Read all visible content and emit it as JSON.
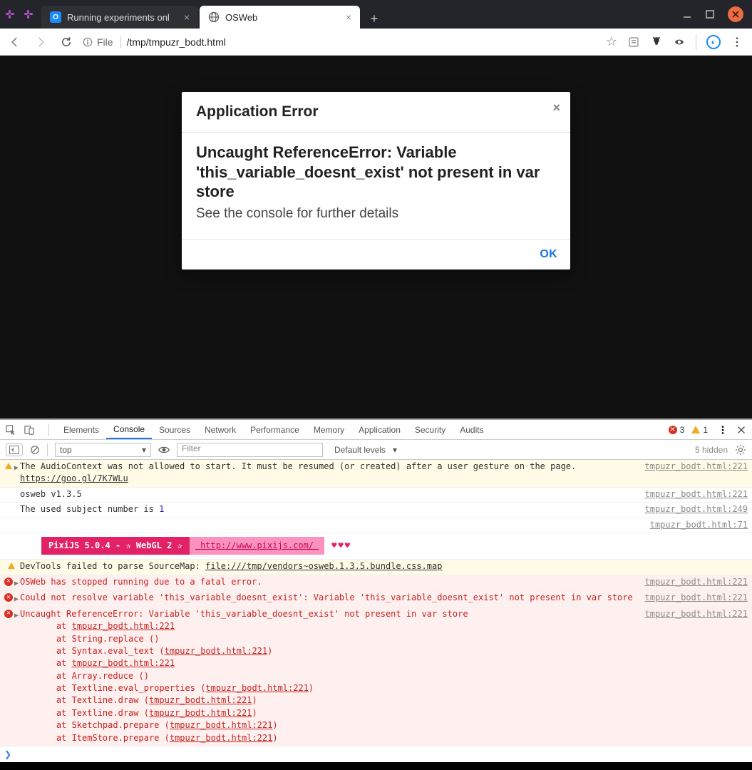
{
  "browser": {
    "tabs": [
      {
        "title": "",
        "icon": "slack"
      },
      {
        "title": "",
        "icon": "slack"
      },
      {
        "title": "Running experiments onl",
        "icon": "os",
        "close": "×"
      },
      {
        "title": "OSWeb",
        "icon": "globe",
        "close": "×",
        "active": true
      }
    ],
    "newtab": "+",
    "win": {
      "min": "—",
      "max": "□",
      "close": "×"
    }
  },
  "addr": {
    "origin": "File",
    "path": "/tmp/tmpuzr_bodt.html",
    "star": "☆"
  },
  "dialog": {
    "title": "Application Error",
    "close": "×",
    "heading": "Uncaught ReferenceError: Variable 'this_variable_doesnt_exist' not present in var store",
    "sub": "See the console for further details",
    "ok": "OK"
  },
  "devtools": {
    "panels": [
      "Elements",
      "Console",
      "Sources",
      "Network",
      "Performance",
      "Memory",
      "Application",
      "Security",
      "Audits"
    ],
    "active_panel": "Console",
    "err_count": "3",
    "warn_count": "1",
    "toolbar": {
      "context": "top",
      "filter_ph": "Filter",
      "levels": "Default levels",
      "hidden": "5 hidden"
    },
    "rows": [
      {
        "type": "warn",
        "expand": true,
        "msg_a": "The AudioContext was not allowed to start. It must be resumed (or created) after a user gesture on the page. ",
        "link": "https://goo.gl/7K7WLu",
        "src": "tmpuzr_bodt.html:221"
      },
      {
        "type": "log",
        "msg": "osweb v1.3.5",
        "src": "tmpuzr_bodt.html:221"
      },
      {
        "type": "log",
        "msg_a": "The used subject number is ",
        "num": "1",
        "src": "tmpuzr_bodt.html:249"
      },
      {
        "type": "src_only",
        "src": "tmpuzr_bodt.html:71"
      },
      {
        "type": "pixi",
        "badge": "PixiJS 5.0.4 - ✰ WebGL 2 ✰",
        "url": " http://www.pixijs.com/ ",
        "hearts": "♥♥♥"
      },
      {
        "type": "warn",
        "msg_a": "DevTools failed to parse SourceMap: ",
        "link": "file:///tmp/vendors~osweb.1.3.5.bundle.css.map"
      },
      {
        "type": "err",
        "expand": true,
        "msg": "OSWeb has stopped running due to a fatal error.",
        "src": "tmpuzr_bodt.html:221"
      },
      {
        "type": "err",
        "expand": true,
        "msg": "Could not resolve variable 'this_variable_doesnt_exist': Variable 'this_variable_doesnt_exist' not present in var store",
        "src": "tmpuzr_bodt.html:221"
      },
      {
        "type": "err",
        "expand": true,
        "msg": "Uncaught ReferenceError: Variable 'this_variable_doesnt_exist' not present in var store",
        "src": "tmpuzr_bodt.html:221",
        "stack": [
          {
            "pre": "    at ",
            "link": "tmpuzr_bodt.html:221"
          },
          {
            "pre": "    at String.replace (<anonymous>)"
          },
          {
            "pre": "    at Syntax.eval_text (",
            "link": "tmpuzr_bodt.html:221",
            "suf": ")"
          },
          {
            "pre": "    at ",
            "link": "tmpuzr_bodt.html:221"
          },
          {
            "pre": "    at Array.reduce (<anonymous>)"
          },
          {
            "pre": "    at Textline.eval_properties (",
            "link": "tmpuzr_bodt.html:221",
            "suf": ")"
          },
          {
            "pre": "    at Textline.draw (",
            "link": "tmpuzr_bodt.html:221",
            "suf": ")"
          },
          {
            "pre": "    at Textline.draw (",
            "link": "tmpuzr_bodt.html:221",
            "suf": ")"
          },
          {
            "pre": "    at Sketchpad.prepare (",
            "link": "tmpuzr_bodt.html:221",
            "suf": ")"
          },
          {
            "pre": "    at ItemStore.prepare (",
            "link": "tmpuzr_bodt.html:221",
            "suf": ")"
          }
        ]
      }
    ],
    "prompt": "❯"
  }
}
